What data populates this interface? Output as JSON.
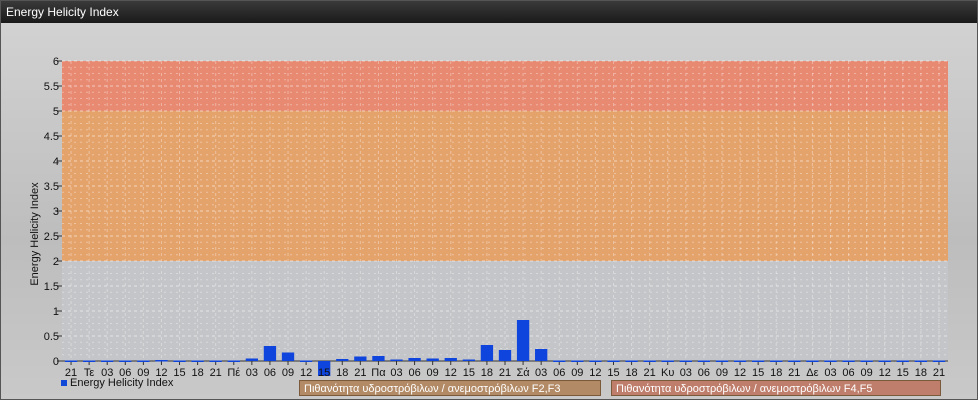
{
  "window": {
    "title": "Energy Helicity Index"
  },
  "colors": {
    "bar": "#0f45dc",
    "band_low": "#c3c5c8",
    "band_mid": "#e5a36c",
    "band_high": "#e88a72",
    "legend_f23": "#b28a66",
    "legend_f45": "#bf7d6c"
  },
  "legend": {
    "series_label": "Energy Helicity Index",
    "band1_label": "Πιθανότητα υδροστρόβιλων / ανεμοστρόβιλων F2,F3",
    "band2_label": "Πιθανότητα υδροστρόβιλων / ανεμοστρόβιλων F4,F5"
  },
  "chart_data": {
    "type": "bar",
    "title": "Energy Helicity Index",
    "ylabel": "Energy Helicity Index",
    "ylim": [
      0,
      6
    ],
    "yticks": [
      "0",
      "0.5",
      "1",
      "1.5",
      "2",
      "2.5",
      "3",
      "3.5",
      "4",
      "4.5",
      "5",
      "5.5",
      "6"
    ],
    "bands": [
      {
        "from": 2,
        "to": 5,
        "label": "Πιθανότητα υδροστρόβιλων / ανεμοστρόβιλων F2,F3"
      },
      {
        "from": 5,
        "to": 6,
        "label": "Πιθανότητα υδροστρόβιλων / ανεμοστρόβιλων F4,F5"
      }
    ],
    "categories": [
      "21",
      "Τε",
      "03",
      "06",
      "09",
      "12",
      "15",
      "18",
      "21",
      "Πέ",
      "03",
      "06",
      "09",
      "12",
      "15",
      "18",
      "21",
      "Πα",
      "03",
      "06",
      "09",
      "12",
      "15",
      "18",
      "21",
      "Σά",
      "03",
      "06",
      "09",
      "12",
      "15",
      "18",
      "21",
      "Κυ",
      "03",
      "06",
      "09",
      "12",
      "15",
      "18",
      "21",
      "Δε",
      "03",
      "06",
      "09",
      "12",
      "15",
      "18",
      "21"
    ],
    "series": [
      {
        "name": "Energy Helicity Index",
        "values": [
          0.01,
          0.01,
          0.01,
          0.01,
          0.01,
          0.02,
          0.01,
          0.01,
          0.01,
          0.01,
          0.05,
          0.3,
          0.17,
          0.01,
          -0.3,
          0.04,
          0.09,
          0.1,
          0.03,
          0.06,
          0.05,
          0.06,
          0.03,
          0.32,
          0.22,
          0.82,
          0.24,
          0.01,
          0.01,
          0.01,
          0.01,
          0.01,
          0.01,
          0.01,
          0.01,
          0.01,
          0.01,
          0.01,
          0.01,
          0.01,
          0.01,
          0.01,
          0.01,
          0.01,
          0.01,
          0.01,
          0.01,
          0.01,
          0.01
        ]
      }
    ]
  }
}
